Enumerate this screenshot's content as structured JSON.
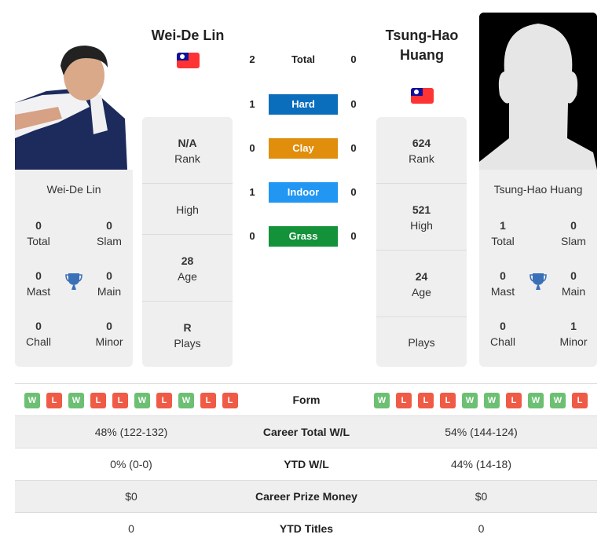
{
  "players": {
    "left": {
      "name": "Wei-De Lin",
      "card_name": "Wei-De Lin",
      "flag": "taiwan-flag",
      "stats": {
        "rank": {
          "value": "N/A",
          "label": "Rank"
        },
        "high": {
          "value": "",
          "label": "High"
        },
        "age": {
          "value": "28",
          "label": "Age"
        },
        "plays": {
          "value": "R",
          "label": "Plays"
        }
      },
      "titles": {
        "total": {
          "value": "0",
          "label": "Total"
        },
        "slam": {
          "value": "0",
          "label": "Slam"
        },
        "mast": {
          "value": "0",
          "label": "Mast"
        },
        "main": {
          "value": "0",
          "label": "Main"
        },
        "chall": {
          "value": "0",
          "label": "Chall"
        },
        "minor": {
          "value": "0",
          "label": "Minor"
        }
      },
      "form": [
        "W",
        "L",
        "W",
        "L",
        "L",
        "W",
        "L",
        "W",
        "L",
        "L"
      ]
    },
    "right": {
      "name": "Tsung-Hao Huang",
      "card_name": "Tsung-Hao Huang",
      "flag": "taiwan-flag",
      "stats": {
        "rank": {
          "value": "624",
          "label": "Rank"
        },
        "high": {
          "value": "521",
          "label": "High"
        },
        "age": {
          "value": "24",
          "label": "Age"
        },
        "plays": {
          "value": "",
          "label": "Plays"
        }
      },
      "titles": {
        "total": {
          "value": "1",
          "label": "Total"
        },
        "slam": {
          "value": "0",
          "label": "Slam"
        },
        "mast": {
          "value": "0",
          "label": "Mast"
        },
        "main": {
          "value": "0",
          "label": "Main"
        },
        "chall": {
          "value": "0",
          "label": "Chall"
        },
        "minor": {
          "value": "1",
          "label": "Minor"
        }
      },
      "form": [
        "W",
        "L",
        "L",
        "L",
        "W",
        "W",
        "L",
        "W",
        "W",
        "L"
      ]
    }
  },
  "h2h": [
    {
      "label": "Total",
      "left": "2",
      "right": "0",
      "color": null
    },
    {
      "label": "Hard",
      "left": "1",
      "right": "0",
      "color": "#0a6ebd"
    },
    {
      "label": "Clay",
      "left": "0",
      "right": "0",
      "color": "#e08e0b"
    },
    {
      "label": "Indoor",
      "left": "1",
      "right": "0",
      "color": "#2196f3"
    },
    {
      "label": "Grass",
      "left": "0",
      "right": "0",
      "color": "#13923a"
    }
  ],
  "table": {
    "form_label": "Form",
    "rows": [
      {
        "label": "Career Total W/L",
        "left": "48% (122-132)",
        "right": "54% (144-124)"
      },
      {
        "label": "YTD W/L",
        "left": "0% (0-0)",
        "right": "44% (14-18)"
      },
      {
        "label": "Career Prize Money",
        "left": "$0",
        "right": "$0"
      },
      {
        "label": "YTD Titles",
        "left": "0",
        "right": "0"
      }
    ]
  },
  "colors": {
    "win": "#6cbf73",
    "loss": "#ef5b46",
    "trophy": "#3a70b8"
  }
}
